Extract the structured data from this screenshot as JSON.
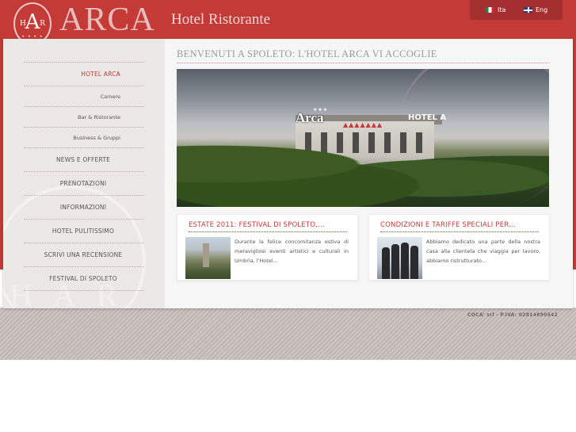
{
  "header": {
    "logo": {
      "letter": "A",
      "left_letter": "H",
      "right_letter": "R",
      "dots": "• • • •"
    },
    "brand_name": "ARCA",
    "tagline": "Hotel Ristorante"
  },
  "languages": [
    {
      "label": "Ita",
      "flag": "flag-italy-icon"
    },
    {
      "label": "Eng",
      "flag": "flag-uk-icon"
    }
  ],
  "sidebar": {
    "nav": [
      {
        "label": "HOTEL ARCA",
        "type": "main",
        "active": true
      },
      {
        "label": "Camere",
        "type": "sub"
      },
      {
        "label": "Bar & Ristorante",
        "type": "sub"
      },
      {
        "label": "Business & Gruppi",
        "type": "sub"
      },
      {
        "label": "NEWS E OFFERTE",
        "type": "main"
      },
      {
        "label": "PRENOTAZIONI",
        "type": "main"
      },
      {
        "label": "INFORMAZIONI",
        "type": "main"
      },
      {
        "label": "HOTEL PULITISSIMO",
        "type": "main"
      },
      {
        "label": "SCRIVI UNA RECENSIONE",
        "type": "main"
      },
      {
        "label": "FESTIVAL DI SPOLETO",
        "type": "main"
      }
    ],
    "watermark": "HAR"
  },
  "main": {
    "title": "BENVENUTI A SPOLETO: L'HOTEL ARCA VI ACCOGLIE",
    "hero": {
      "sign": "Arca",
      "stars": "★★★",
      "sign2": "HOTEL A"
    },
    "cards": [
      {
        "title": "ESTATE 2011: FESTIVAL DI SPOLETO,...",
        "text": "Durante la felice concomitanza estiva di meravigliosi eventi artistici e culturali in Umbria, l'Hotel..."
      },
      {
        "title": "CONDIZIONI E TARIFFE SPECIALI PER...",
        "text": "Abbiamo dedicato una parte della nostra casa alla clientela che viaggia per lavoro, abbiamo ristrutturato..."
      }
    ]
  },
  "footer": {
    "credit": "COCA' srl - P.IVA: 02814890542"
  },
  "colors": {
    "brand_red": "#c33a37",
    "dark_red": "#a3302e",
    "sidebar_bg": "#ebe8e8"
  }
}
